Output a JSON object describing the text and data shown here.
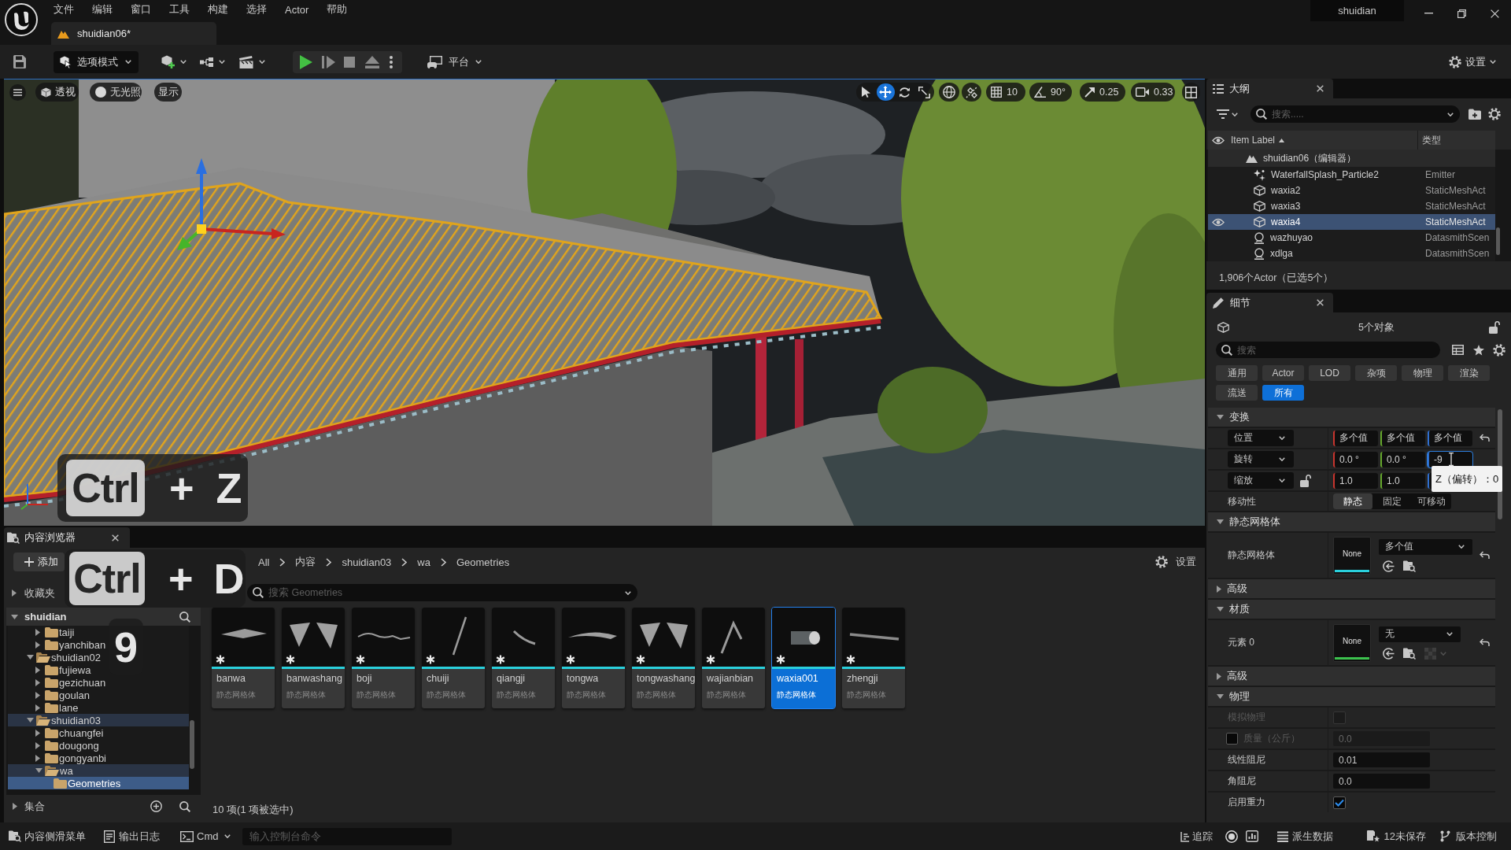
{
  "menu_bar": {
    "items": [
      "文件",
      "编辑",
      "窗口",
      "工具",
      "构建",
      "选择",
      "Actor",
      "帮助"
    ],
    "user": "shuidian"
  },
  "document_tab": {
    "title": "shuidian06*"
  },
  "toolbar": {
    "mode_button": "选项模式",
    "platform_button": "平台",
    "settings_button": "设置"
  },
  "viewport": {
    "view_buttons": [
      {
        "kind": "perspective",
        "label": "透视"
      },
      {
        "kind": "lighting",
        "label": "无光照"
      },
      {
        "kind": "show",
        "label": "显示"
      }
    ],
    "transform_tools": [
      {
        "kind": "select",
        "selected": false
      },
      {
        "kind": "move",
        "selected": true
      },
      {
        "kind": "rotate",
        "selected": false
      },
      {
        "kind": "scale",
        "selected": false
      }
    ],
    "snap_settings": [
      {
        "kind": "grid",
        "label": "10"
      },
      {
        "kind": "angle",
        "label": "90°"
      },
      {
        "kind": "scale",
        "label": "0.25"
      },
      {
        "kind": "camera",
        "label": "0.33"
      }
    ]
  },
  "key_overlays": [
    {
      "keycap": "Ctrl",
      "plus": "+",
      "key": "Z"
    },
    {
      "keycap": "Ctrl",
      "plus": "+",
      "key": "D"
    },
    {
      "key": "9"
    }
  ],
  "outliner": {
    "title": "大纲",
    "search_placeholder": "搜索.....",
    "columns": [
      "Item Label",
      "类型"
    ],
    "rows": [
      {
        "label": "shuidian06（编辑器）",
        "kind": "level",
        "selected": false,
        "children": [
          {
            "label": "WaterfallSplash_Particle2",
            "type": "Emitter",
            "kind": "emitter",
            "selected": false
          },
          {
            "label": "waxia2",
            "type": "StaticMeshAct",
            "kind": "mesh",
            "selected": false
          },
          {
            "label": "waxia3",
            "type": "StaticMeshAct",
            "kind": "mesh",
            "selected": false
          },
          {
            "label": "waxia4",
            "type": "StaticMeshAct",
            "kind": "mesh",
            "selected": true
          },
          {
            "label": "wazhuyao",
            "type": "DatasmithScen",
            "kind": "datasmith",
            "selected": false
          },
          {
            "label": "xdlga",
            "type": "DatasmithScen",
            "kind": "datasmith",
            "selected": false
          }
        ]
      }
    ],
    "status": "1,906个Actor（已选5个）"
  },
  "details": {
    "title": "细节",
    "object_count": "5个对象",
    "selection_locked": false,
    "search_placeholder": "搜索",
    "filters": [
      {
        "label": "通用",
        "selected": false
      },
      {
        "label": "Actor",
        "selected": false
      },
      {
        "label": "LOD",
        "selected": false
      },
      {
        "label": "杂项",
        "selected": false
      },
      {
        "label": "物理",
        "selected": false
      },
      {
        "label": "渲染",
        "selected": false
      },
      {
        "label": "流送",
        "selected": false
      },
      {
        "label": "所有",
        "selected": true
      }
    ],
    "sections": [
      {
        "title": "变换",
        "expanded": true,
        "rows": [
          {
            "kind": "vector",
            "label": "位置",
            "values": [
              {
                "text": "多个值",
                "focused": false
              },
              {
                "text": "多个值",
                "focused": false
              },
              {
                "text": "多个值",
                "focused": false
              }
            ],
            "resettable": true
          },
          {
            "kind": "vector",
            "label": "旋转",
            "values": [
              {
                "text": "0.0 °",
                "focused": false
              },
              {
                "text": "0.0 °",
                "focused": false
              },
              {
                "text": "-9",
                "focused": true,
                "tooltip": "Z（偏转）：0"
              }
            ],
            "resettable": false
          },
          {
            "kind": "vector",
            "label": "缩放",
            "locked": false,
            "values": [
              {
                "text": "1.0",
                "focused": false
              },
              {
                "text": "1.0",
                "focused": false
              }
            ],
            "resettable": false
          },
          {
            "kind": "segmented",
            "label": "移动性",
            "options": [
              {
                "label": "静态",
                "selected": true
              },
              {
                "label": "固定",
                "selected": false
              },
              {
                "label": "可移动",
                "selected": false
              }
            ]
          }
        ]
      },
      {
        "title": "静态网格体",
        "expanded": true,
        "rows": [
          {
            "kind": "mesh",
            "label": "静态网格体",
            "thumbnail": "None",
            "value": "多个值",
            "color": "#2ad0dc",
            "resettable": true
          }
        ]
      },
      {
        "title": "高级",
        "expanded": false
      },
      {
        "title": "材质",
        "expanded": true,
        "rows": [
          {
            "kind": "material",
            "label": "元素 0",
            "thumbnail": "None",
            "value": "无",
            "color": "#3cc24e",
            "resettable": true
          }
        ]
      },
      {
        "title": "高级",
        "expanded": false
      },
      {
        "title": "物理",
        "expanded": true,
        "rows": [
          {
            "kind": "checkbox",
            "label": "模拟物理",
            "checked": false,
            "disabled": true
          },
          {
            "kind": "number",
            "label": "质量（公斤）",
            "value": "0.0",
            "disabled": true,
            "override": false
          },
          {
            "kind": "number",
            "label": "线性阻尼",
            "value": "0.01",
            "disabled": false
          },
          {
            "kind": "number",
            "label": "角阻尼",
            "value": "0.0",
            "disabled": false
          },
          {
            "kind": "checkbox",
            "label": "启用重力",
            "checked": true,
            "disabled": false
          }
        ]
      }
    ]
  },
  "content_browser": {
    "title": "内容浏览器",
    "add_button": "添加",
    "breadcrumb": [
      "All",
      "内容",
      "shuidian03",
      "wa",
      "Geometries"
    ],
    "settings_button": "设置",
    "favorites": {
      "label": "收藏夹",
      "expanded": false
    },
    "search_placeholder": "搜索 Geometries",
    "tree_root": {
      "label": "shuidian",
      "expanded": true
    },
    "tree": [
      {
        "children": [
          {
            "label": "taiji",
            "expanded": false,
            "selected": false
          },
          {
            "label": "yanchiban",
            "expanded": false,
            "selected": false
          }
        ]
      },
      {
        "label": "shuidian02",
        "expanded": true,
        "selected": false,
        "children": [
          {
            "label": "fujiewa",
            "expanded": false,
            "selected": false
          },
          {
            "label": "gezichuan",
            "expanded": false,
            "selected": false
          },
          {
            "label": "goulan",
            "expanded": false,
            "selected": false
          },
          {
            "label": "lane",
            "expanded": false,
            "selected": false
          }
        ]
      },
      {
        "label": "shuidian03",
        "expanded": true,
        "selected": false,
        "children": [
          {
            "label": "chuangfei",
            "expanded": false,
            "selected": false
          },
          {
            "label": "dougong",
            "expanded": false,
            "selected": false
          },
          {
            "label": "gongyanbi",
            "expanded": false,
            "selected": false
          },
          {
            "label": "wa",
            "expanded": true,
            "selected": false,
            "children": [
              {
                "label": "Geometries",
                "selected": true
              }
            ]
          }
        ]
      }
    ],
    "collections": {
      "label": "集合",
      "expanded": false
    },
    "assets": [
      {
        "name": "banwa",
        "type": "静态网格体",
        "selected": false
      },
      {
        "name": "banwashang",
        "type": "静态网格体",
        "selected": false
      },
      {
        "name": "boji",
        "type": "静态网格体",
        "selected": false
      },
      {
        "name": "chuiji",
        "type": "静态网格体",
        "selected": false
      },
      {
        "name": "qiangji",
        "type": "静态网格体",
        "selected": false
      },
      {
        "name": "tongwa",
        "type": "静态网格体",
        "selected": false
      },
      {
        "name": "tongwashang",
        "type": "静态网格体",
        "selected": false
      },
      {
        "name": "wajianbian",
        "type": "静态网格体",
        "selected": false
      },
      {
        "name": "waxia001",
        "type": "静态网格体",
        "selected": true
      },
      {
        "name": "zhengji",
        "type": "静态网格体",
        "selected": false
      }
    ],
    "item_count": "10 项(1 项被选中)"
  },
  "status_bar": {
    "left": [
      {
        "kind": "drawer",
        "label": "内容侧滑菜单"
      },
      {
        "kind": "log",
        "label": "输出日志"
      },
      {
        "kind": "cmd",
        "label": "Cmd"
      }
    ],
    "console_placeholder": "输入控制台命令",
    "right": [
      {
        "kind": "trace",
        "label": "追踪"
      },
      {
        "kind": "record"
      },
      {
        "kind": "insights"
      },
      {
        "kind": "derived",
        "label": "派生数据"
      },
      {
        "kind": "unsaved",
        "label": "12未保存"
      },
      {
        "kind": "source",
        "label": "版本控制"
      }
    ]
  }
}
